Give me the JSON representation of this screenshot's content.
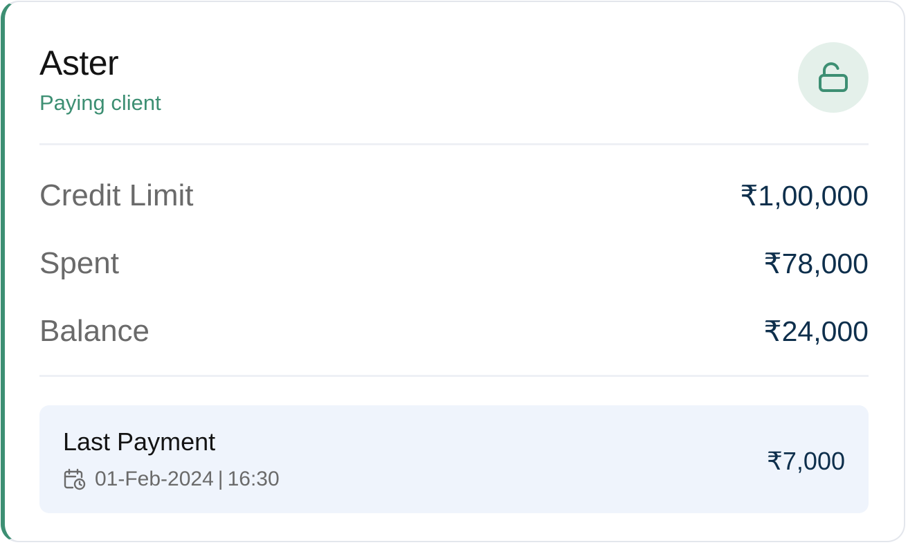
{
  "client": {
    "name": "Aster",
    "status": "Paying client"
  },
  "lock": {
    "icon": "unlock-icon",
    "accent_color": "#3d8f73",
    "background_color": "#e4f0ea"
  },
  "summary": [
    {
      "label": "Credit Limit",
      "value": "₹1,00,000"
    },
    {
      "label": "Spent",
      "value": "₹78,000"
    },
    {
      "label": "Balance",
      "value": "₹24,000"
    }
  ],
  "last_payment": {
    "title": "Last Payment",
    "icon": "calendar-clock-icon",
    "date": "01-Feb-2024",
    "separator": "|",
    "time": "16:30",
    "amount": "₹7,000"
  },
  "colors": {
    "accent": "#3d8f73",
    "amount_text": "#0e2f4c",
    "label_text": "#6a6a6a",
    "payment_panel": "#eff4fc"
  }
}
